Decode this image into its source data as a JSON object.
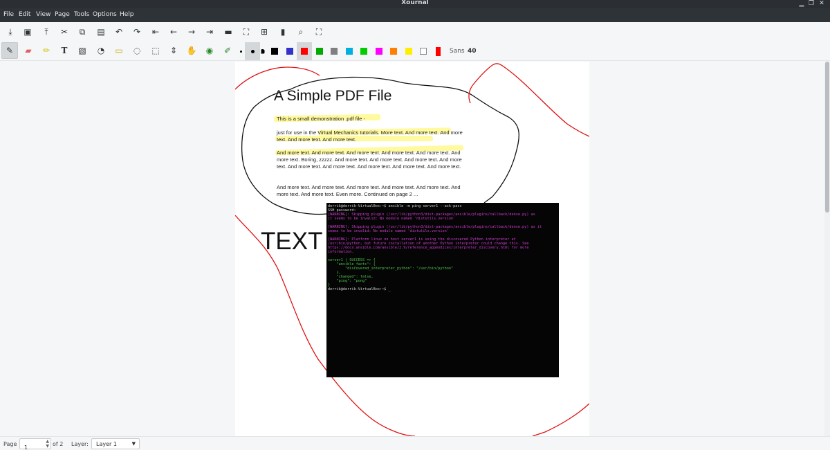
{
  "window": {
    "title": "Xournal"
  },
  "menu": [
    "File",
    "Edit",
    "View",
    "Page",
    "Tools",
    "Options",
    "Help"
  ],
  "toolbar1": [
    {
      "icon": "save-icon"
    },
    {
      "icon": "new-page-icon"
    },
    {
      "icon": "export-icon"
    },
    {
      "icon": "cut-icon"
    },
    {
      "icon": "copy-icon"
    },
    {
      "icon": "paste-icon"
    },
    {
      "icon": "undo-icon"
    },
    {
      "icon": "redo-icon"
    },
    {
      "icon": "first-page-icon"
    },
    {
      "icon": "prev-page-icon"
    },
    {
      "icon": "next-page-icon"
    },
    {
      "icon": "last-page-icon"
    },
    {
      "icon": "zoom-out-icon"
    },
    {
      "icon": "fit-icon"
    },
    {
      "icon": "zoom-in-icon"
    },
    {
      "icon": "normal-size-icon"
    },
    {
      "icon": "find-icon"
    },
    {
      "icon": "fullscreen-icon"
    }
  ],
  "toolbar2": {
    "tools": [
      {
        "icon": "pen-icon",
        "active": true
      },
      {
        "icon": "eraser-icon"
      },
      {
        "icon": "highlighter-icon"
      },
      {
        "icon": "text-tool-icon",
        "glyph": "T"
      },
      {
        "icon": "image-tool-icon"
      },
      {
        "icon": "shape-recognizer-icon"
      },
      {
        "icon": "ruler-icon"
      },
      {
        "icon": "select-region-icon"
      },
      {
        "icon": "select-rect-icon"
      },
      {
        "icon": "vertical-space-icon"
      },
      {
        "icon": "hand-icon"
      },
      {
        "icon": "default-pen-icon"
      },
      {
        "icon": "default-tool-icon"
      }
    ],
    "colors": [
      "#000000",
      "#3333cc",
      "#ff0000",
      "#00aa00",
      "#808080",
      "#00b0e0",
      "#00cc00",
      "#ff00ff",
      "#ff8000",
      "#ffee00",
      "#ffffff",
      "#ff0000"
    ],
    "active_color_index": 2,
    "font_name": "Sans",
    "font_size": "40"
  },
  "document": {
    "pdf_title": "A Simple PDF File",
    "paragraphs": [
      "This is a small demonstration .pdf file -",
      "just for use in the Virtual Mechanics tutorials. More text. And more text. And more text. And more text. And more text.",
      "And more text. And more text. And more text. And more text. And more text. And more text. Boring, zzzzz. And more text. And more text. And more text. And more text. And more text. And more text. And more text. And more text. And more text.",
      "And more text. And more text. And more text. And more text. And more text. And more text. And more text. Even more. Continued on page 2 ..."
    ],
    "annotation_text": "TEXT",
    "terminal": [
      {
        "text": "derrik@derrik-VirtualBox:~$ ansible -m ping server1 --ask-pass",
        "color": "white"
      },
      {
        "text": "SSH password:",
        "color": "white"
      },
      {
        "text": "[WARNING]: Skipping plugin (/usr/lib/python3/dist-packages/ansible/plugins/callback/dense.py) as",
        "color": "magenta"
      },
      {
        "text": "it seems to be invalid: No module named 'distutils.version'",
        "color": "magenta"
      },
      {
        "text": "",
        "color": "white"
      },
      {
        "text": "[WARNING]: Skipping plugin (/usr/lib/python3/dist-packages/ansible/plugins/callback/dense.py) as it",
        "color": "magenta"
      },
      {
        "text": "seems to be invalid: No module named 'distutils.version'",
        "color": "magenta"
      },
      {
        "text": "",
        "color": "white"
      },
      {
        "text": "[WARNING]: Platform linux on host server1 is using the discovered Python interpreter at",
        "color": "magenta"
      },
      {
        "text": "/usr/bin/python, but future installation of another Python interpreter could change this. See",
        "color": "magenta"
      },
      {
        "text": "https://docs.ansible.com/ansible/2.9/reference_appendices/interpreter_discovery.html for more",
        "color": "magenta"
      },
      {
        "text": "information.",
        "color": "magenta"
      },
      {
        "text": "",
        "color": "white"
      },
      {
        "text": "server1 | SUCCESS => {",
        "color": "green"
      },
      {
        "text": "    \"ansible_facts\": {",
        "color": "green"
      },
      {
        "text": "        \"discovered_interpreter_python\": \"/usr/bin/python\"",
        "color": "green"
      },
      {
        "text": "    },",
        "color": "green"
      },
      {
        "text": "    \"changed\": false,",
        "color": "green"
      },
      {
        "text": "    \"ping\": \"pong\"",
        "color": "green"
      },
      {
        "text": "}",
        "color": "green"
      },
      {
        "text": "derrik@derrik-VirtualBox:~$ _",
        "color": "white"
      }
    ]
  },
  "status": {
    "page_label": "Page",
    "page_value": "1",
    "of_label": "of 2",
    "layer_label": "Layer:",
    "layer_value": "Layer 1"
  }
}
